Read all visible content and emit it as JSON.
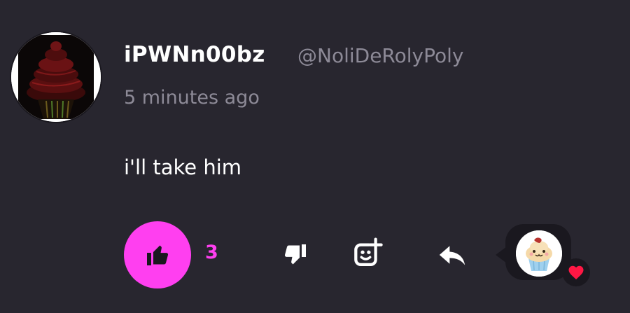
{
  "comment": {
    "author": {
      "username": "iPWNn00bz",
      "handle": "@NoliDeRolyPoly",
      "avatar_icon": "dark-red-cupcake-avatar"
    },
    "timestamp": "5 minutes ago",
    "text": "i'll take him"
  },
  "actions": {
    "like_count": "3",
    "like_icon": "thumbs-up-icon",
    "dislike_icon": "thumbs-down-icon",
    "react_icon": "add-reaction-icon",
    "reply_icon": "reply-arrow-icon",
    "reactor": {
      "avatar_icon": "cupcake-avatar",
      "reaction_icon": "heart-icon"
    }
  },
  "colors": {
    "background": "#28262f",
    "accent": "#ff3ff0",
    "muted_text": "#8d8a97",
    "heart": "#ff1744"
  }
}
